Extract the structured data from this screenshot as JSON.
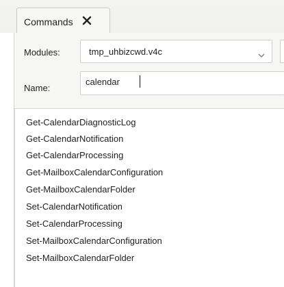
{
  "tabs": [
    {
      "label": "Commands"
    }
  ],
  "form": {
    "modules_label": "Modules:",
    "modules_value": "tmp_uhbizcwd.v4c",
    "name_label": "Name:",
    "name_value": "calendar"
  },
  "results": [
    {
      "label": "Get-CalendarDiagnosticLog"
    },
    {
      "label": "Get-CalendarNotification"
    },
    {
      "label": "Get-CalendarProcessing"
    },
    {
      "label": "Get-MailboxCalendarConfiguration"
    },
    {
      "label": "Get-MailboxCalendarFolder"
    },
    {
      "label": "Set-CalendarNotification"
    },
    {
      "label": "Set-CalendarProcessing"
    },
    {
      "label": "Set-MailboxCalendarConfiguration"
    },
    {
      "label": "Set-MailboxCalendarFolder"
    }
  ],
  "icons": {
    "tab_close": "close-icon",
    "dropdown": "chevron-down-icon"
  }
}
